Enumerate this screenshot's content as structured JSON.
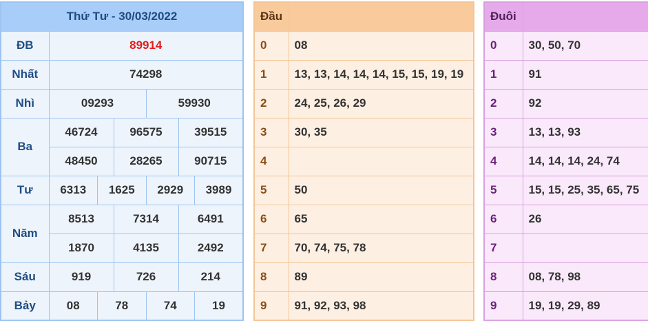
{
  "results": {
    "header": "Thứ Tư - 30/03/2022",
    "db": {
      "label": "ĐB",
      "value": "89914"
    },
    "nhat": {
      "label": "Nhất",
      "value": "74298"
    },
    "nhi": {
      "label": "Nhì",
      "values": [
        "09293",
        "59930"
      ]
    },
    "ba": {
      "label": "Ba",
      "values": [
        "46724",
        "96575",
        "39515",
        "48450",
        "28265",
        "90715"
      ]
    },
    "tu": {
      "label": "Tư",
      "values": [
        "6313",
        "1625",
        "2929",
        "3989"
      ]
    },
    "nam": {
      "label": "Năm",
      "values": [
        "8513",
        "7314",
        "6491",
        "1870",
        "4135",
        "2492"
      ]
    },
    "sau": {
      "label": "Sáu",
      "values": [
        "919",
        "726",
        "214"
      ]
    },
    "bay": {
      "label": "Bảy",
      "values": [
        "08",
        "78",
        "74",
        "19"
      ]
    }
  },
  "dau": {
    "header": "Đầu",
    "rows": [
      {
        "key": "0",
        "value": "08"
      },
      {
        "key": "1",
        "value": "13, 13, 14, 14, 14, 15, 15, 19, 19"
      },
      {
        "key": "2",
        "value": "24, 25, 26, 29"
      },
      {
        "key": "3",
        "value": "30, 35"
      },
      {
        "key": "4",
        "value": ""
      },
      {
        "key": "5",
        "value": "50"
      },
      {
        "key": "6",
        "value": "65"
      },
      {
        "key": "7",
        "value": "70, 74, 75, 78"
      },
      {
        "key": "8",
        "value": "89"
      },
      {
        "key": "9",
        "value": "91, 92, 93, 98"
      }
    ]
  },
  "duoi": {
    "header": "Đuôi",
    "rows": [
      {
        "key": "0",
        "value": "30, 50, 70"
      },
      {
        "key": "1",
        "value": "91"
      },
      {
        "key": "2",
        "value": "92"
      },
      {
        "key": "3",
        "value": "13, 13, 93"
      },
      {
        "key": "4",
        "value": "14, 14, 14, 24, 74"
      },
      {
        "key": "5",
        "value": "15, 15, 25, 35, 65, 75"
      },
      {
        "key": "6",
        "value": "26"
      },
      {
        "key": "7",
        "value": ""
      },
      {
        "key": "8",
        "value": "08, 78, 98"
      },
      {
        "key": "9",
        "value": "19, 19, 29, 89"
      }
    ]
  },
  "colors": {
    "results_header_bg": "#a9cdf9",
    "results_cell_bg": "#eef4fc",
    "special_prize": "#e31b1b",
    "dau_header_bg": "#f9ca9c",
    "dau_cell_bg": "#fdefe2",
    "duoi_header_bg": "#e6aaea",
    "duoi_cell_bg": "#f9e9fa"
  }
}
